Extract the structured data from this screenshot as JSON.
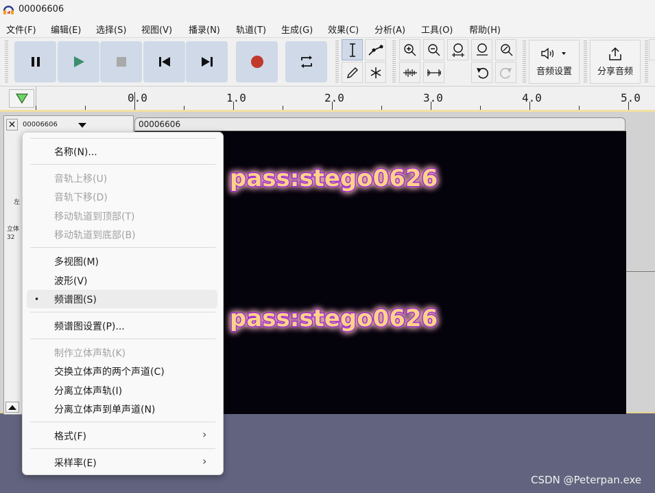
{
  "window": {
    "title": "00006606"
  },
  "menu": [
    "文件(F)",
    "编辑(E)",
    "选择(S)",
    "视图(V)",
    "播录(N)",
    "轨道(T)",
    "生成(G)",
    "效果(C)",
    "分析(A)",
    "工具(O)",
    "帮助(H)"
  ],
  "toolbar": {
    "audio_setup_label": "音频设置",
    "share_audio_label": "分享音频"
  },
  "ruler": {
    "ticks": [
      "0.0",
      "1.0",
      "2.0",
      "3.0",
      "4.0",
      "5.0"
    ]
  },
  "track": {
    "name": "00006606",
    "clip_name": "00006606",
    "side_labels": [
      "左",
      "立体",
      "32"
    ],
    "spectrogram_text": [
      "pass:stego0626",
      "pass:stego0626"
    ]
  },
  "context_menu": {
    "name": "名称(N)...",
    "move_up": "音轨上移(U)",
    "move_down": "音轨下移(D)",
    "move_top": "移动轨道到顶部(T)",
    "move_bottom": "移动轨道到底部(B)",
    "multiview": "多视图(M)",
    "waveform": "波形(V)",
    "spectrogram": "频谱图(S)",
    "spectrogram_settings": "频谱图设置(P)...",
    "make_stereo": "制作立体声轨(K)",
    "swap_channels": "交换立体声的两个声道(C)",
    "split_stereo": "分离立体声轨(I)",
    "split_to_mono": "分离立体声到单声道(N)",
    "format": "格式(F)",
    "sample_rate": "采样率(E)"
  },
  "watermark": "CSDN @Peterpan.exe",
  "colors": {
    "accent": "#cfd9e8",
    "record": "#c0392b",
    "play": "#3c8f6e",
    "selection_border": "#f3e0a0"
  }
}
